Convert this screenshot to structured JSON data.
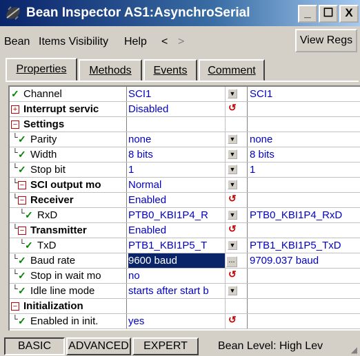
{
  "window": {
    "title": "Bean Inspector AS1:AsynchroSerial",
    "minimize": "_",
    "maximize": "☐",
    "close": "X"
  },
  "menu": {
    "bean": "Bean",
    "items_visibility": "Items Visibility",
    "help": "Help",
    "back": "<",
    "forward": ">",
    "view_regs": "View Regs"
  },
  "tabs": [
    {
      "label": "Properties",
      "active": true
    },
    {
      "label": "Methods",
      "active": false
    },
    {
      "label": "Events",
      "active": false
    },
    {
      "label": "Comment",
      "active": false
    }
  ],
  "rows": [
    {
      "name": "Channel",
      "value": "SCI1",
      "control": "dropdown",
      "info": "SCI1",
      "bold": false,
      "mark": "check",
      "indent": 0
    },
    {
      "name": "Interrupt servic",
      "value": "Disabled",
      "control": "undo",
      "info": "",
      "bold": true,
      "mark": "plus",
      "indent": 0
    },
    {
      "name": "Settings",
      "value": "",
      "control": "",
      "info": "",
      "bold": true,
      "mark": "minus",
      "indent": 0
    },
    {
      "name": "Parity",
      "value": "none",
      "control": "dropdown",
      "info": "none",
      "bold": false,
      "mark": "check",
      "indent": 1
    },
    {
      "name": "Width",
      "value": "8 bits",
      "control": "dropdown",
      "info": "8 bits",
      "bold": false,
      "mark": "check",
      "indent": 1
    },
    {
      "name": "Stop bit",
      "value": "1",
      "control": "dropdown",
      "info": "1",
      "bold": false,
      "mark": "check",
      "indent": 1
    },
    {
      "name": "SCI output mo",
      "value": "Normal",
      "control": "dropdown",
      "info": "",
      "bold": true,
      "mark": "minus",
      "indent": 1
    },
    {
      "name": "Receiver",
      "value": "Enabled",
      "control": "undo",
      "info": "",
      "bold": true,
      "mark": "minus",
      "indent": 1
    },
    {
      "name": "RxD",
      "value": "PTB0_KBI1P4_R",
      "control": "dropdown",
      "info": "PTB0_KBI1P4_RxD",
      "bold": false,
      "mark": "check",
      "indent": 2
    },
    {
      "name": "Transmitter",
      "value": "Enabled",
      "control": "undo",
      "info": "",
      "bold": true,
      "mark": "minus",
      "indent": 1
    },
    {
      "name": "TxD",
      "value": "PTB1_KBI1P5_T",
      "control": "dropdown",
      "info": "PTB1_KBI1P5_TxD",
      "bold": false,
      "mark": "check",
      "indent": 2
    },
    {
      "name": "Baud rate",
      "value": "9600 baud",
      "control": "dots",
      "info": "9709.037 baud",
      "bold": false,
      "mark": "check",
      "indent": 1,
      "selected": true
    },
    {
      "name": "Stop in wait mo",
      "value": "no",
      "control": "undo",
      "info": "",
      "bold": false,
      "mark": "check",
      "indent": 1
    },
    {
      "name": "Idle line mode",
      "value": "starts after start b",
      "control": "dropdown",
      "info": "",
      "bold": false,
      "mark": "check",
      "indent": 1
    },
    {
      "name": "Initialization",
      "value": "",
      "control": "",
      "info": "",
      "bold": true,
      "mark": "minus",
      "indent": 0
    },
    {
      "name": "Enabled in init.",
      "value": "yes",
      "control": "undo",
      "info": "",
      "bold": false,
      "mark": "check",
      "indent": 1
    }
  ],
  "status": {
    "basic": "BASIC",
    "advanced": "ADVANCED",
    "expert": "EXPERT",
    "bean_level": "Bean Level: High Lev"
  },
  "colors": {
    "title_start": "#0a246a",
    "value_text": "#0000cc",
    "check": "#008000",
    "selection": "#0a246a"
  }
}
